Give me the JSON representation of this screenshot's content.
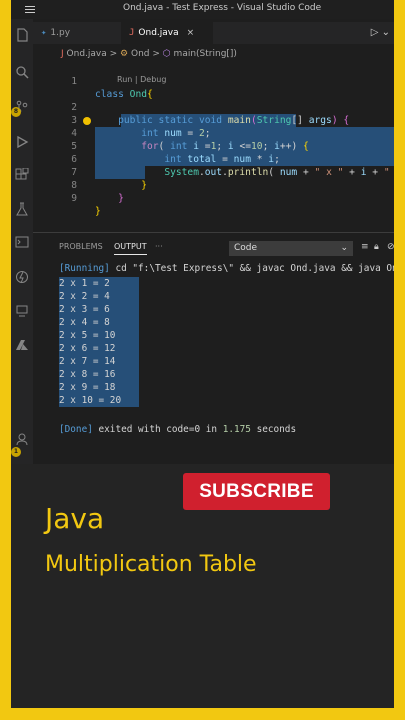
{
  "window": {
    "title": "Ond.java - Test Express - Visual Studio Code"
  },
  "tabs": [
    {
      "icon": "python-icon",
      "label": "1.py",
      "active": false
    },
    {
      "icon": "java-icon",
      "label": "Ond.java",
      "active": true,
      "close": "×"
    }
  ],
  "breadcrumb": {
    "file": "Ond.java",
    "sep1": ">",
    "cls": "Ond",
    "sep2": ">",
    "method": "main(String[])"
  },
  "codelens": "Run | Debug",
  "editor": {
    "line_numbers": [
      "1",
      "2",
      "3",
      "4",
      "5",
      "6",
      "7",
      "8",
      "9"
    ],
    "code": [
      "class Ond{",
      "    public static void main(String[] args) {",
      "        int num = 2;",
      "        for( int i =1; i <=10; i++) {",
      "            int total = num * i;",
      "            System.out.println( num + \" x \" + i + \" = \" + total);",
      "        }",
      "    }",
      "}"
    ]
  },
  "panel": {
    "tabs": [
      "PROBLEMS",
      "OUTPUT",
      "···"
    ],
    "channel": "Code",
    "chevron": "⌄",
    "tool_icons": [
      "list-filter-icon",
      "copy-icon",
      "lock-icon",
      "clear-icon"
    ],
    "output": {
      "running_tag": "[Running]",
      "command": " cd \"f:\\Test Express\\\" && javac Ond.java && java Ond",
      "lines": [
        "2 x 1 = 2",
        "2 x 2 = 4",
        "2 x 3 = 6",
        "2 x 4 = 8",
        "2 x 5 = 10",
        "2 x 6 = 12",
        "2 x 7 = 14",
        "2 x 8 = 16",
        "2 x 9 = 18",
        "2 x 10 = 20"
      ],
      "done_tag": "[Done]",
      "done_text": " exited with code=0 in ",
      "done_time": "1.175",
      "done_unit": " seconds"
    }
  },
  "activity_badges": {
    "source_control": "8",
    "accounts": "1"
  },
  "promo": {
    "subscribe": "SUBSCRIBE",
    "line1": "Java",
    "line2": "Multiplication Table"
  },
  "colors": {
    "frame": "#f2c811",
    "subscribe_bg": "#d0202e",
    "promo_text": "#f2c811"
  }
}
